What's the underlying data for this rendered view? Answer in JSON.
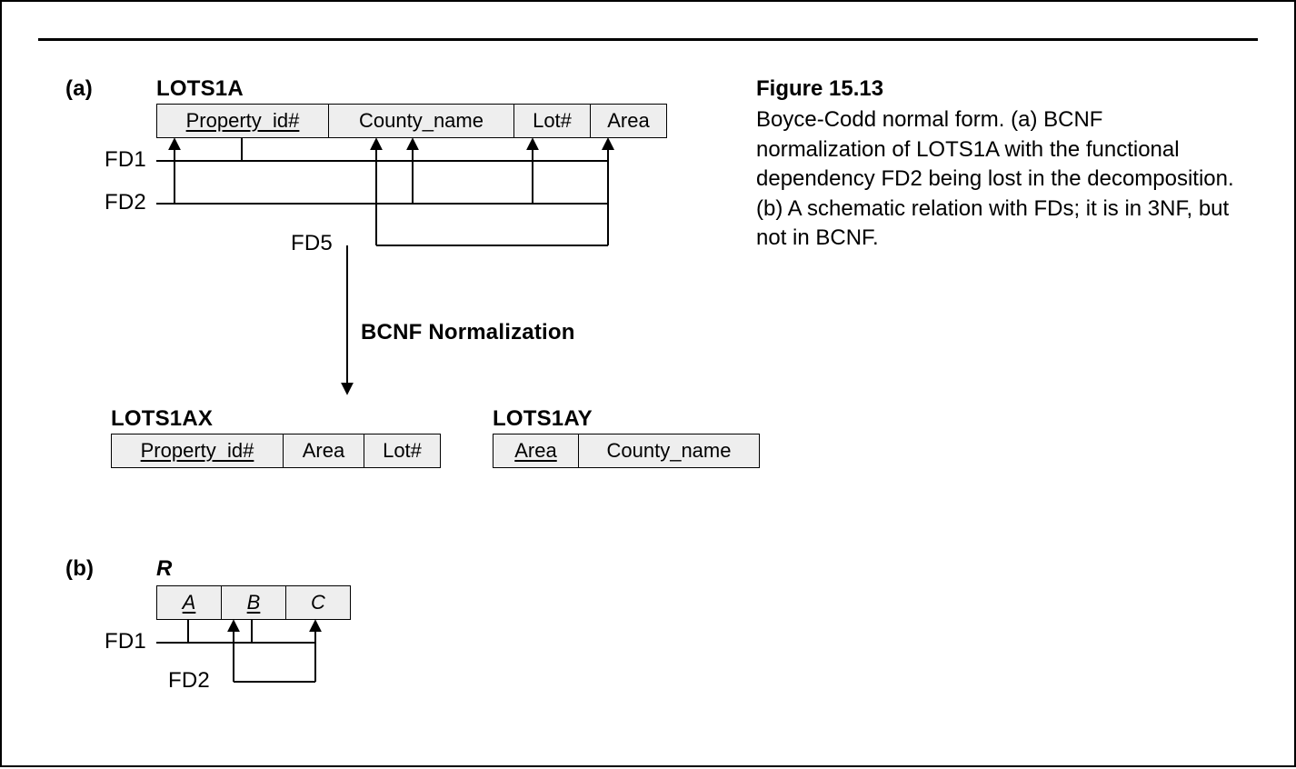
{
  "figure_label": "Figure 15.13",
  "caption": "Boyce-Codd normal form. (a) BCNF normalization of LOTS1A with the functional dependency FD2 being lost in the decomposition. (b) A schematic relation with FDs; it is in 3NF, but not in BCNF.",
  "part_a_label": "(a)",
  "part_b_label": "(b)",
  "lots1a_name": "LOTS1A",
  "lots1a_attrs": {
    "property_id": "Property_id#",
    "county_name": "County_name",
    "lot": "Lot#",
    "area": "Area"
  },
  "fd1_label": "FD1",
  "fd2_label": "FD2",
  "fd5_label": "FD5",
  "bcnf_label": "BCNF Normalization",
  "lots1ax_name": "LOTS1AX",
  "lots1ax_attrs": {
    "property_id": "Property_id#",
    "area": "Area",
    "lot": "Lot#"
  },
  "lots1ay_name": "LOTS1AY",
  "lots1ay_attrs": {
    "area": "Area",
    "county_name": "County_name"
  },
  "r_name": "R",
  "r_attrs": {
    "a": "A",
    "b": "B",
    "c": "C"
  },
  "r_fd1_label": "FD1",
  "r_fd2_label": "FD2"
}
